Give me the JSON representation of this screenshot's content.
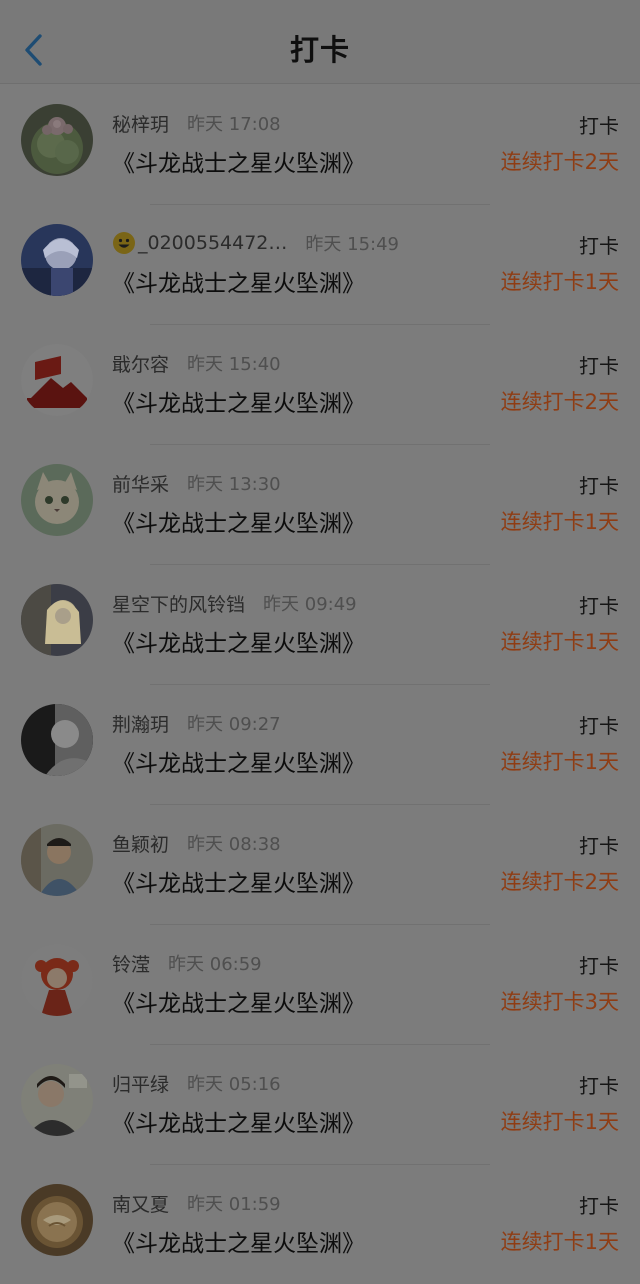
{
  "header": {
    "title": "打卡"
  },
  "colors": {
    "streak": "#8f3d14",
    "back_arrow": "#1e4c73"
  },
  "checkins": [
    {
      "name": "秘梓玥",
      "time": "昨天 17:08",
      "book": "《斗龙战士之星火坠渊》",
      "action": "打卡",
      "streak": "连续打卡2天",
      "avatar": "cactus-photo"
    },
    {
      "name": "_0200554472…",
      "name_prefix_icon": "smiley-emoji-icon",
      "time": "昨天 15:49",
      "book": "《斗龙战士之星火坠渊》",
      "action": "打卡",
      "streak": "连续打卡1天",
      "avatar": "anime-boy-illustration"
    },
    {
      "name": "戢尔容",
      "time": "昨天 15:40",
      "book": "《斗龙战士之星火坠渊》",
      "action": "打卡",
      "streak": "连续打卡2天",
      "avatar": "flag-logo"
    },
    {
      "name": "前华采",
      "time": "昨天 13:30",
      "book": "《斗龙战士之星火坠渊》",
      "action": "打卡",
      "streak": "连续打卡1天",
      "avatar": "cat-photo"
    },
    {
      "name": "星空下的风铃铛",
      "time": "昨天 09:49",
      "book": "《斗龙战士之星火坠渊》",
      "action": "打卡",
      "streak": "连续打卡1天",
      "avatar": "anime-girl-illustration"
    },
    {
      "name": "荆瀚玥",
      "time": "昨天 09:27",
      "book": "《斗龙战士之星火坠渊》",
      "action": "打卡",
      "streak": "连续打卡1天",
      "avatar": "monochrome-portrait"
    },
    {
      "name": "鱼颖初",
      "time": "昨天 08:38",
      "book": "《斗龙战士之星火坠渊》",
      "action": "打卡",
      "streak": "连续打卡2天",
      "avatar": "boy-photo"
    },
    {
      "name": "铃滢",
      "time": "昨天 06:59",
      "book": "《斗龙战士之星火坠渊》",
      "action": "打卡",
      "streak": "连续打卡3天",
      "avatar": "cartoon-redhair-illustration"
    },
    {
      "name": "归平绿",
      "time": "昨天 05:16",
      "book": "《斗龙战士之星火坠渊》",
      "action": "打卡",
      "streak": "连续打卡1天",
      "avatar": "young-man-photo"
    },
    {
      "name": "南又夏",
      "time": "昨天 01:59",
      "book": "《斗龙战士之星火坠渊》",
      "action": "打卡",
      "streak": "连续打卡1天",
      "avatar": "latte-art-photo"
    }
  ]
}
